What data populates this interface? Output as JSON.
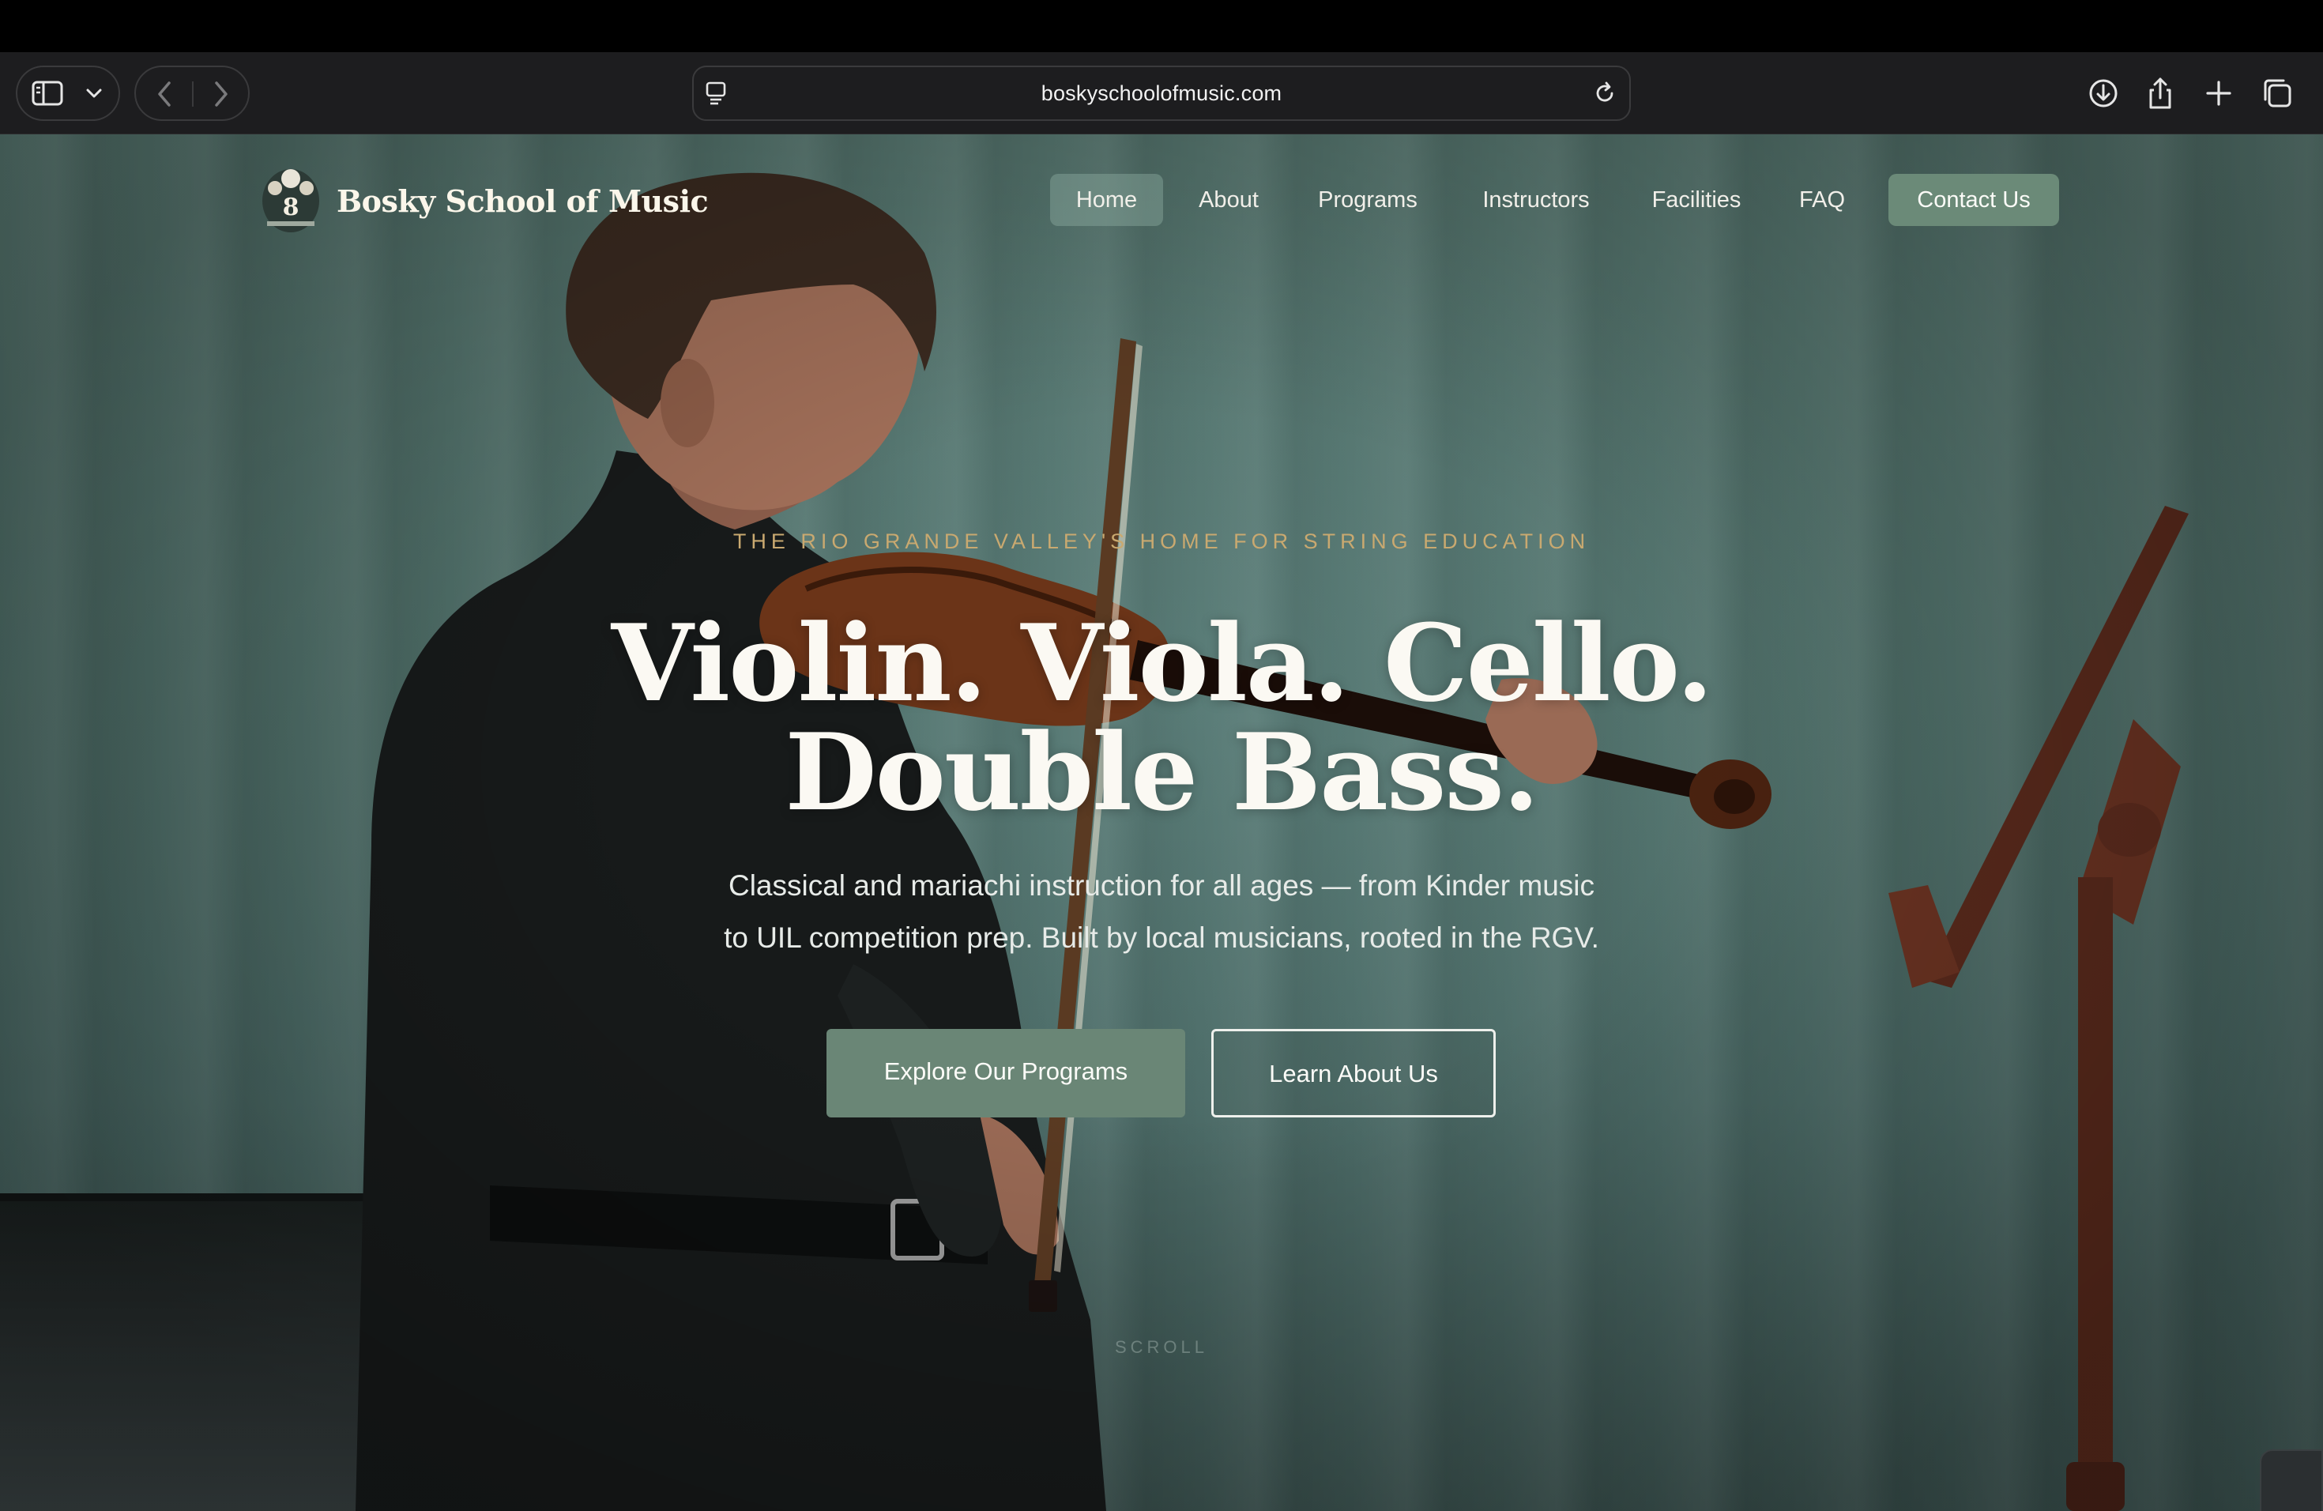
{
  "browser": {
    "url": "boskyschoolofmusic.com",
    "icons": [
      "sidebar-icon",
      "chevron-down-icon",
      "back-icon",
      "forward-icon",
      "page-settings-icon",
      "reload-icon",
      "download-icon",
      "share-icon",
      "new-tab-icon",
      "tabs-overview-icon"
    ]
  },
  "site": {
    "brand": "Bosky School of Music",
    "nav": {
      "home": "Home",
      "about": "About",
      "programs": "Programs",
      "instructors": "Instructors",
      "facilities": "Facilities",
      "faq": "FAQ",
      "contact": "Contact Us"
    },
    "active_nav": "Home"
  },
  "hero": {
    "eyebrow": "THE RIO GRANDE VALLEY'S HOME FOR STRING EDUCATION",
    "headline_line1": "Violin. Viola. Cello.",
    "headline_line2": "Double Bass.",
    "subtext_line1": "Classical and mariachi instruction for all ages — from Kinder music",
    "subtext_line2": "to UIL competition prep. Built by local musicians, rooted in the RGV.",
    "primary_cta": "Explore Our Programs",
    "secondary_cta": "Learn About Us",
    "scroll_hint": "SCROLL"
  },
  "colors": {
    "accent_green": "#6a8676",
    "eyebrow_gold": "#c9a970",
    "hero_teal": "#56766f"
  }
}
